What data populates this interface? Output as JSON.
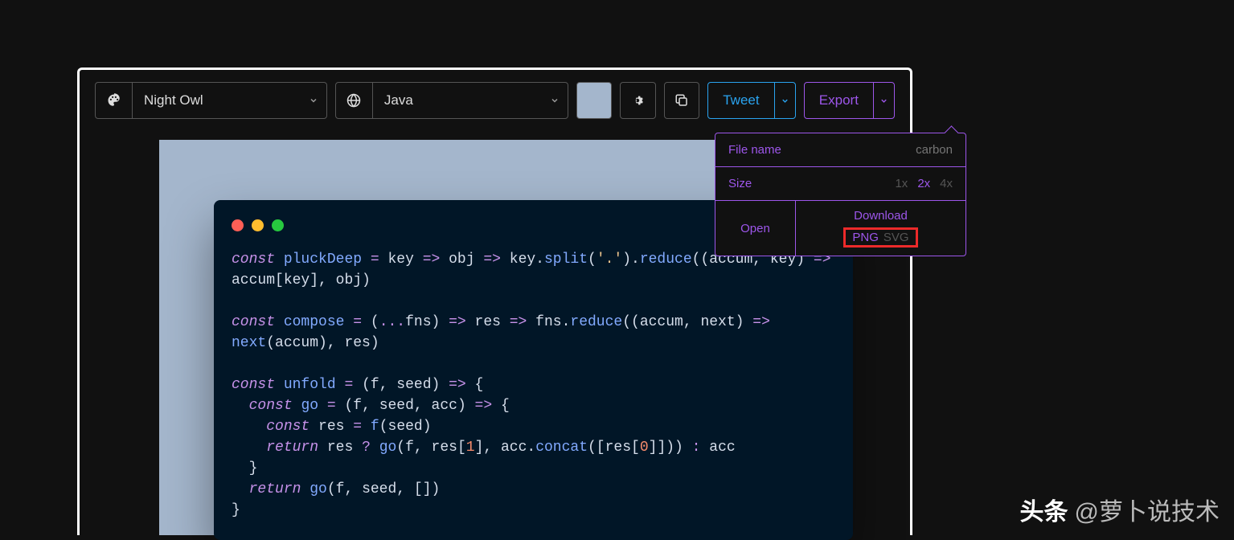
{
  "toolbar": {
    "theme_label": "Night Owl",
    "language_label": "Java",
    "tweet_label": "Tweet",
    "export_label": "Export"
  },
  "export_popover": {
    "filename_label": "File name",
    "filename_placeholder": "carbon",
    "size_label": "Size",
    "sizes": {
      "x1": "1x",
      "x2": "2x",
      "x4": "4x"
    },
    "active_size": "2x",
    "open_label": "Open",
    "download_label": "Download",
    "format_png": "PNG",
    "format_svg": "SVG"
  },
  "code": {
    "lines": [
      {
        "t": "const",
        "raw": "const pluckDeep = key => obj => key.split('.').reduce((accum, key) => accum[key], obj)"
      },
      {
        "raw": ""
      },
      {
        "raw": "const compose = (...fns) => res => fns.reduce((accum, next) => next(accum), res)"
      },
      {
        "raw": ""
      },
      {
        "raw": "const unfold = (f, seed) => {"
      },
      {
        "raw": "  const go = (f, seed, acc) => {"
      },
      {
        "raw": "    const res = f(seed)"
      },
      {
        "raw": "    return res ? go(f, res[1], acc.concat([res[0]])) : acc"
      },
      {
        "raw": "  }"
      },
      {
        "raw": "  return go(f, seed, [])"
      },
      {
        "raw": "}"
      }
    ]
  },
  "colors": {
    "accent_export": "#9d56ea",
    "accent_tweet": "#2aa3ef",
    "bg_swatch": "#a4b6cc",
    "code_bg": "#011627"
  },
  "watermark": {
    "brand": "头条",
    "handle": "@萝卜说技术"
  }
}
